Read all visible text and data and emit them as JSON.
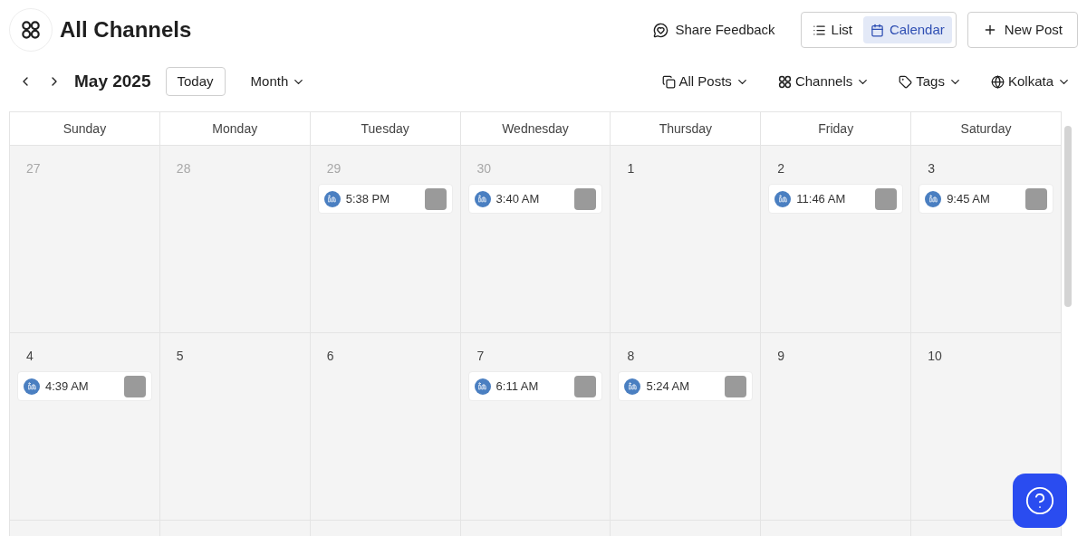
{
  "header": {
    "title": "All Channels",
    "feedback": "Share Feedback",
    "views": [
      {
        "label": "List",
        "selected": false
      },
      {
        "label": "Calendar",
        "selected": true
      }
    ],
    "new_post": "New Post"
  },
  "toolbar": {
    "month": "May 2025",
    "today": "Today",
    "range": "Month",
    "filters": [
      {
        "kind": "posts",
        "label": "All Posts"
      },
      {
        "kind": "channels",
        "label": "Channels"
      },
      {
        "kind": "tags",
        "label": "Tags"
      },
      {
        "kind": "timezone",
        "label": "Kolkata"
      }
    ]
  },
  "calendar": {
    "weekdays": [
      "Sunday",
      "Monday",
      "Tuesday",
      "Wednesday",
      "Thursday",
      "Friday",
      "Saturday"
    ],
    "weeks": [
      [
        {
          "day": "27",
          "outside": true
        },
        {
          "day": "28",
          "outside": true
        },
        {
          "day": "29",
          "outside": true,
          "posts": [
            {
              "time": "5:38 PM"
            }
          ]
        },
        {
          "day": "30",
          "outside": true,
          "posts": [
            {
              "time": "3:40 AM"
            }
          ]
        },
        {
          "day": "1",
          "outside": false
        },
        {
          "day": "2",
          "outside": false,
          "posts": [
            {
              "time": "11:46 AM"
            }
          ]
        },
        {
          "day": "3",
          "outside": false,
          "posts": [
            {
              "time": "9:45 AM"
            }
          ]
        }
      ],
      [
        {
          "day": "4",
          "outside": false,
          "posts": [
            {
              "time": "4:39 AM"
            }
          ]
        },
        {
          "day": "5",
          "outside": false
        },
        {
          "day": "6",
          "outside": false
        },
        {
          "day": "7",
          "outside": false,
          "posts": [
            {
              "time": "6:11 AM"
            }
          ]
        },
        {
          "day": "8",
          "outside": false,
          "posts": [
            {
              "time": "5:24 AM"
            }
          ]
        },
        {
          "day": "9",
          "outside": false
        },
        {
          "day": "10",
          "outside": false
        }
      ]
    ]
  }
}
